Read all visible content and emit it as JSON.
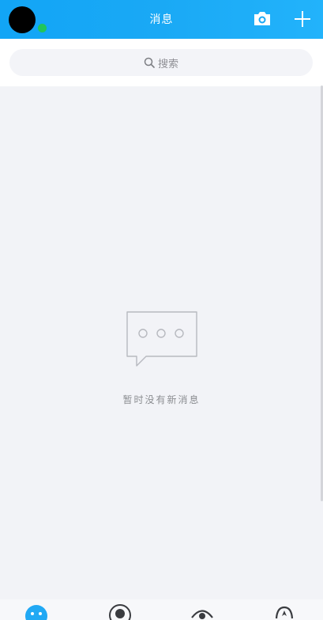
{
  "header": {
    "title": "消息",
    "avatar_icon": "avatar",
    "status_icon": "online-dot-icon",
    "camera_icon": "camera-icon",
    "add_icon": "plus-icon"
  },
  "search": {
    "placeholder": "搜索",
    "icon": "search-icon"
  },
  "empty": {
    "icon": "chat-bubble-icon",
    "text": "暂时没有新消息"
  },
  "tabbar": {
    "tabs": [
      {
        "icon": "message-tab-icon",
        "active": true
      },
      {
        "icon": "contacts-tab-icon",
        "active": false
      },
      {
        "icon": "watch-tab-icon",
        "active": false
      },
      {
        "icon": "explore-tab-icon",
        "active": false
      }
    ]
  },
  "colors": {
    "header": "#1aa9f5",
    "online": "#21c55b",
    "background": "#f2f3f7"
  }
}
